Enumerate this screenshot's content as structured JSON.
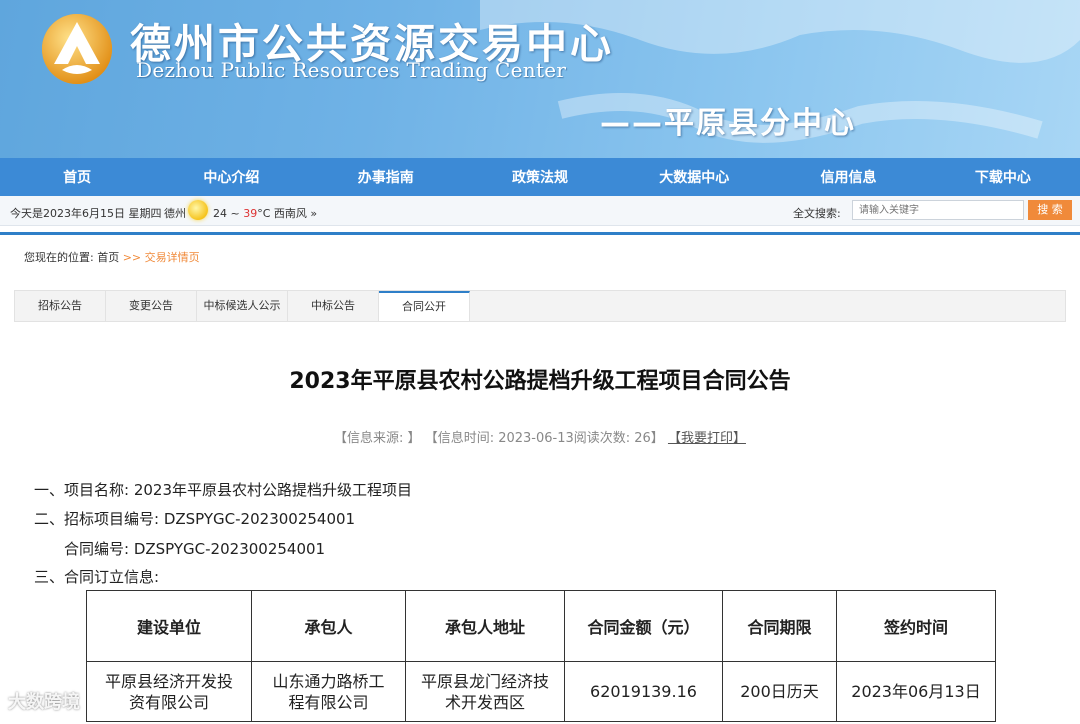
{
  "header": {
    "title_cn": "德州市公共资源交易中心",
    "title_en": "Dezhou Public Resources Trading Center",
    "branch": "——平原县分中心",
    "logo_icon": "trading-center-logo",
    "colors": {
      "banner": "#6fb2e6",
      "nav": "#3c8ad6",
      "accent": "#f08a3a",
      "logo_gold": "#f2a51c"
    }
  },
  "nav": {
    "items": [
      "首页",
      "中心介绍",
      "办事指南",
      "政策法规",
      "大数据中心",
      "信用信息",
      "下载中心"
    ]
  },
  "infobar": {
    "date": "今天是2023年6月15日 星期四",
    "city": "德州",
    "weather_icon": "sun-icon",
    "temp_low": "24 ~ ",
    "temp_high": "39",
    "temp_tail": "°C 西南风 »",
    "search_label": "全文搜索:",
    "search_placeholder": "请输入关键字",
    "search_button": "搜 索"
  },
  "breadcrumb": {
    "label": "您现在的位置:",
    "home": "首页",
    "sep": " >> ",
    "current": "交易详情页"
  },
  "tabs": {
    "items": [
      "招标公告",
      "变更公告",
      "中标候选人公示",
      "中标公告",
      "合同公开"
    ],
    "active_index": 4
  },
  "article": {
    "title": "2023年平原县农村公路提档升级工程项目合同公告",
    "meta_source": "【信息来源: 】",
    "meta_time": "【信息时间: 2023-06-13阅读次数: 26】",
    "meta_print": "【我要打印】",
    "line1": "一、项目名称: 2023年平原县农村公路提档升级工程项目",
    "line2": "二、招标项目编号: DZSPYGC-202300254001",
    "line3": "合同编号: DZSPYGC-202300254001",
    "line4": "三、合同订立信息:"
  },
  "table": {
    "headers": [
      "建设单位",
      "承包人",
      "承包人地址",
      "合同金额（元）",
      "合同期限",
      "签约时间"
    ],
    "row": [
      "平原县经济开发投资有限公司",
      "山东通力路桥工程有限公司",
      "平原县龙门经济技术开发西区",
      "62019139.16",
      "200日历天",
      "2023年06月13日"
    ]
  },
  "watermark": "大数跨境"
}
